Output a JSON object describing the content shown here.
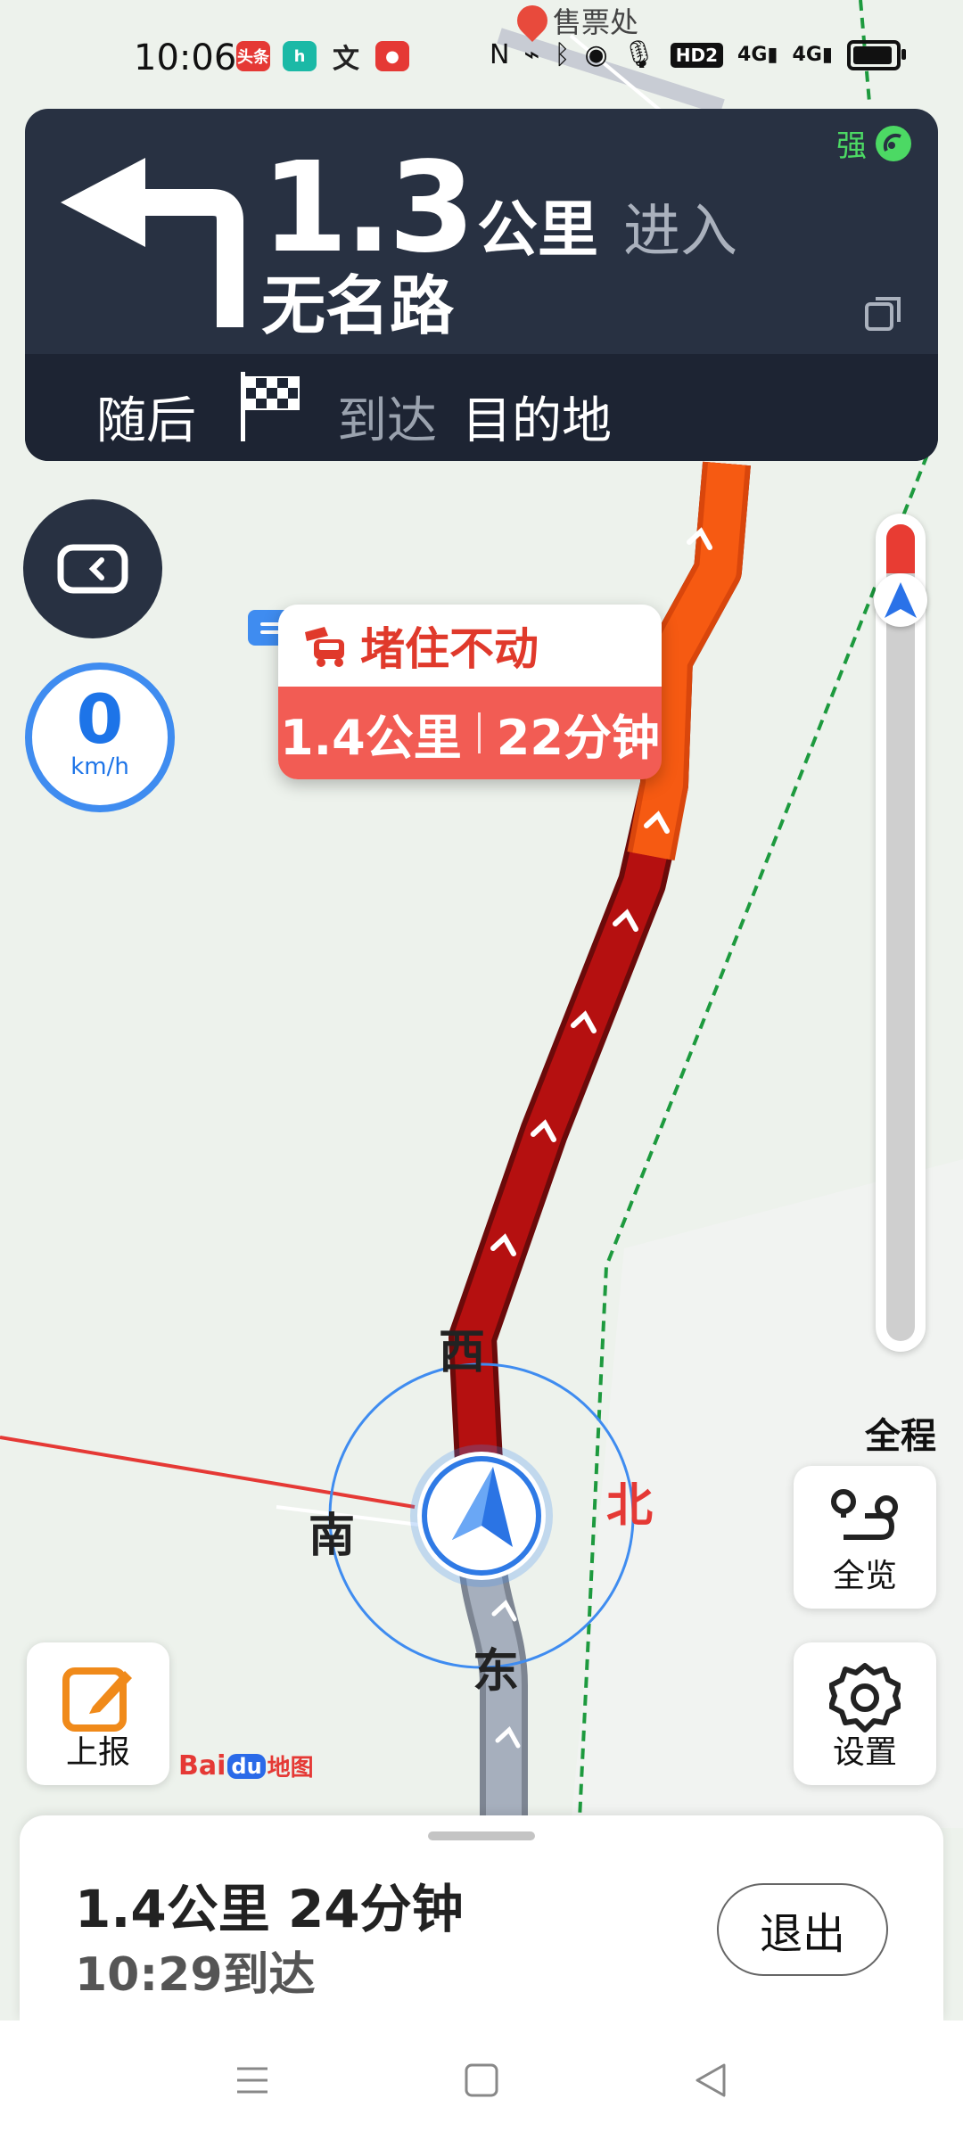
{
  "status_bar": {
    "time": "10:06",
    "apps": [
      {
        "icon": "toutiao-icon",
        "text": "头条",
        "color": "#e53935"
      },
      {
        "icon": "h-app-icon",
        "text": "h",
        "color": "#1bb9a6"
      },
      {
        "icon": "translate-icon",
        "text": "文",
        "color": "#222222"
      },
      {
        "icon": "record-icon",
        "text": "●",
        "color": "#e53935"
      }
    ],
    "right_icons": [
      "nfc-icon",
      "vibrate-icon",
      "bluetooth-icon",
      "location-icon",
      "mic-icon"
    ],
    "hd_label": "HD2",
    "signal1": "4G",
    "signal2": "4G"
  },
  "map": {
    "poi_label": "售票处"
  },
  "guidance": {
    "distance_value": "1.3",
    "distance_unit": "公里",
    "action": "进入",
    "road_name": "无名路",
    "gps_strength": "强",
    "next_label": "随后",
    "next_action": "到达",
    "next_target": "目的地"
  },
  "speed": {
    "value": "0",
    "unit": "km/h"
  },
  "traffic_bubble": {
    "title": "堵住不动",
    "distance": "1.4公里",
    "duration": "22分钟"
  },
  "compass": {
    "west": "西",
    "south": "南",
    "north": "北",
    "east": "东"
  },
  "route_progress": {
    "label": "全程",
    "traversed_fraction": 0.06
  },
  "buttons": {
    "overview": "全览",
    "settings": "设置",
    "report": "上报"
  },
  "logo": {
    "brand_left": "Bai",
    "brand_mid": "du",
    "brand_right": "地图"
  },
  "summary": {
    "remaining": "1.4公里 24分钟",
    "arrival": "10:29到达",
    "exit_label": "退出"
  },
  "colors": {
    "panel": "#283142",
    "congestion_dark": "#b30f0f",
    "congestion_orange": "#f2560e",
    "accent_blue": "#3f8cf0"
  }
}
